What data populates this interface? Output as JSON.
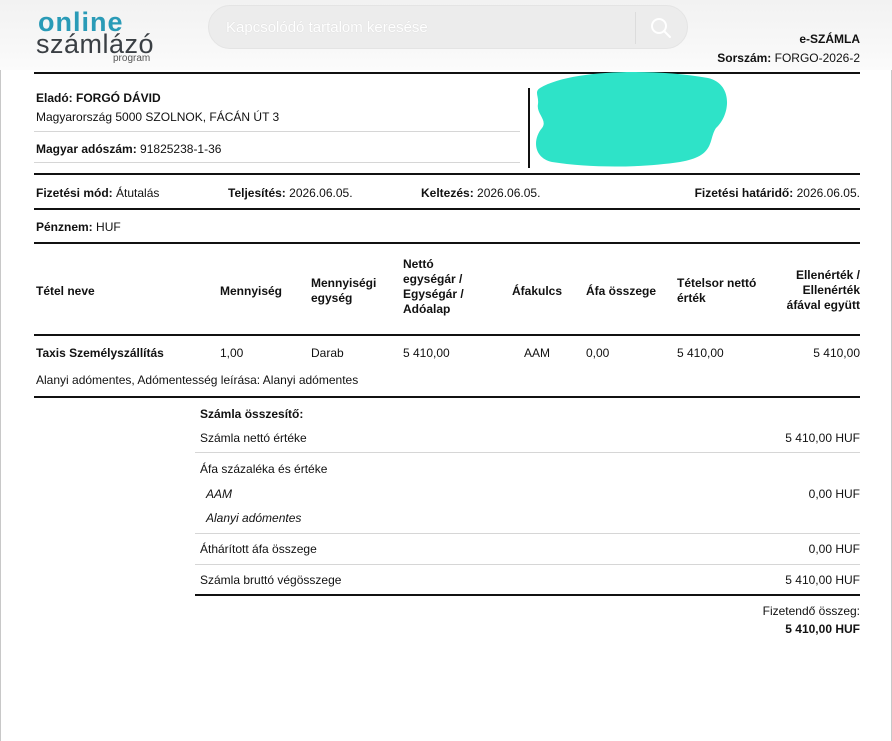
{
  "header": {
    "logo": {
      "line1": "online",
      "line2": "számlázó",
      "line3": "program"
    },
    "search_placeholder": "Kapcsolódó tartalom keresése",
    "doc_type": "e-SZÁMLA",
    "serial_label": "Sorszám:",
    "serial_value": "FORGO-2026-2"
  },
  "seller": {
    "label": "Eladó:",
    "name": "FORGÓ DÁVID",
    "address": "Magyarország 5000 SZOLNOK, FÁCÁN ÚT 3",
    "tax_label": "Magyar adószám:",
    "tax_value": "91825238-1-36"
  },
  "meta": {
    "payment_label": "Fizetési mód:",
    "payment_value": "Átutalás",
    "fulfilment_label": "Teljesítés:",
    "fulfilment_value": "2026.06.05.",
    "issue_label": "Keltezés:",
    "issue_value": "2026.06.05.",
    "due_label": "Fizetési határidő:",
    "due_value": "2026.06.05.",
    "currency_label": "Pénznem:",
    "currency_value": "HUF"
  },
  "table": {
    "headers": {
      "name": "Tétel neve",
      "qty": "Mennyiség",
      "unit": [
        "Mennyiségi",
        "egység"
      ],
      "net_unit": [
        "Nettó",
        "egységár /",
        "Egységár /",
        "Adóalap"
      ],
      "vat_rate": "Áfakulcs",
      "vat_amount": "Áfa összege",
      "net_line": [
        "Tételsor nettó",
        "érték"
      ],
      "gross": [
        "Ellenérték /",
        "Ellenérték",
        "áfával együtt"
      ]
    },
    "row": {
      "name": "Taxis Személyszállítás",
      "qty": "1,00",
      "unit": "Darab",
      "net_unit": "5 410,00",
      "vat_rate": "AAM",
      "vat_amount": "0,00",
      "net_line": "5 410,00",
      "gross": "5 410,00"
    },
    "note": "Alanyi adómentes, Adómentesség leírása: Alanyi adómentes"
  },
  "summary": {
    "title": "Számla összesítő:",
    "net_label": "Számla nettó értéke",
    "net_value": "5 410,00 HUF",
    "vat_label": "Áfa százaléka és értéke",
    "vat_code": "AAM",
    "vat_value": "0,00 HUF",
    "vat_note": "Alanyi adómentes",
    "transferred_label": "Áthárított áfa összege",
    "transferred_value": "0,00 HUF",
    "gross_label": "Számla bruttó végösszege",
    "gross_value": "5 410,00 HUF",
    "payable_label": "Fizetendő összeg:",
    "payable_value": "5 410,00 HUF"
  },
  "colors": {
    "brand": "#2a9bb7",
    "redaction": "#2ee3c8"
  }
}
